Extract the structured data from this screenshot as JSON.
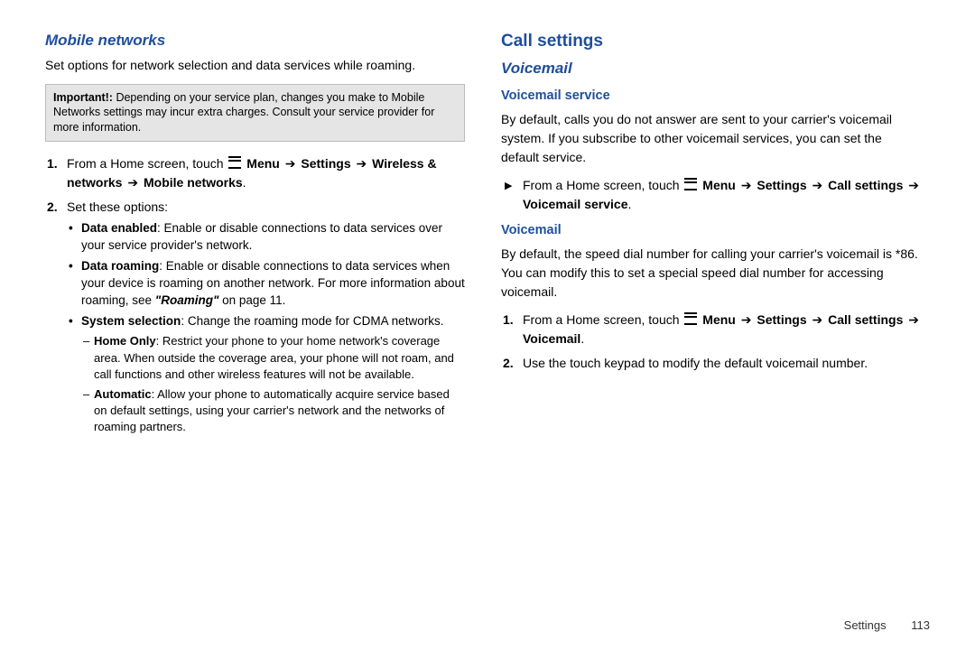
{
  "left": {
    "mobile_networks_heading": "Mobile networks",
    "mobile_networks_intro": "Set options for network selection and data services while roaming.",
    "important_label": "Important!:",
    "important_text": "Depending on your service plan, changes you make to Mobile Networks settings may incur extra charges. Consult your service provider for more information.",
    "step1_prefix": "From a Home screen, touch ",
    "step1_menu": "Menu",
    "step1_settings": "Settings",
    "step1_wireless": "Wireless & networks",
    "step1_mobile": "Mobile networks",
    "step2": "Set these options:",
    "bullet_data_enabled_label": "Data enabled",
    "bullet_data_enabled_text": ": Enable or disable connections to data services over your service provider's network.",
    "bullet_data_roaming_label": "Data roaming",
    "bullet_data_roaming_text": ": Enable or disable connections to data services when your device is roaming on another network. For more information about roaming, see ",
    "bullet_data_roaming_ref": "\"Roaming\"",
    "bullet_data_roaming_tail": " on page 11.",
    "bullet_system_selection_label": "System selection",
    "bullet_system_selection_text": ": Change the roaming mode for CDMA networks.",
    "dash_home_only_label": "Home Only",
    "dash_home_only_text": ": Restrict your phone to your home network's coverage area. When outside the coverage area, your phone will not roam, and call functions and other wireless features will not be available.",
    "dash_automatic_label": "Automatic",
    "dash_automatic_text": ": Allow your phone to automatically acquire service based on default settings, using your carrier's network and the networks of roaming partners."
  },
  "right": {
    "call_settings_heading": "Call settings",
    "voicemail_heading": "Voicemail",
    "voicemail_service_heading": "Voicemail service",
    "voicemail_service_text": "By default, calls you do not answer are sent to your carrier's voicemail system. If you subscribe to other voicemail services, you can set the default service.",
    "vs_step_prefix": "From a Home screen, touch ",
    "vs_menu": "Menu",
    "vs_settings": "Settings",
    "vs_call_settings": "Call settings",
    "vs_voicemail_service": "Voicemail service",
    "voicemail2_heading": "Voicemail",
    "voicemail2_text": "By default, the speed dial number for calling your carrier's voicemail is *86. You can modify this to set a special speed dial number for accessing voicemail.",
    "vm_step1_prefix": "From a Home screen, touch ",
    "vm_menu": "Menu",
    "vm_settings": "Settings",
    "vm_call_settings": "Call settings",
    "vm_voicemail": "Voicemail",
    "vm_step2": "Use the touch keypad to modify the default voicemail number."
  },
  "footer": {
    "section": "Settings",
    "page": "113"
  },
  "glyphs": {
    "arrow": "➔",
    "dot": "."
  }
}
